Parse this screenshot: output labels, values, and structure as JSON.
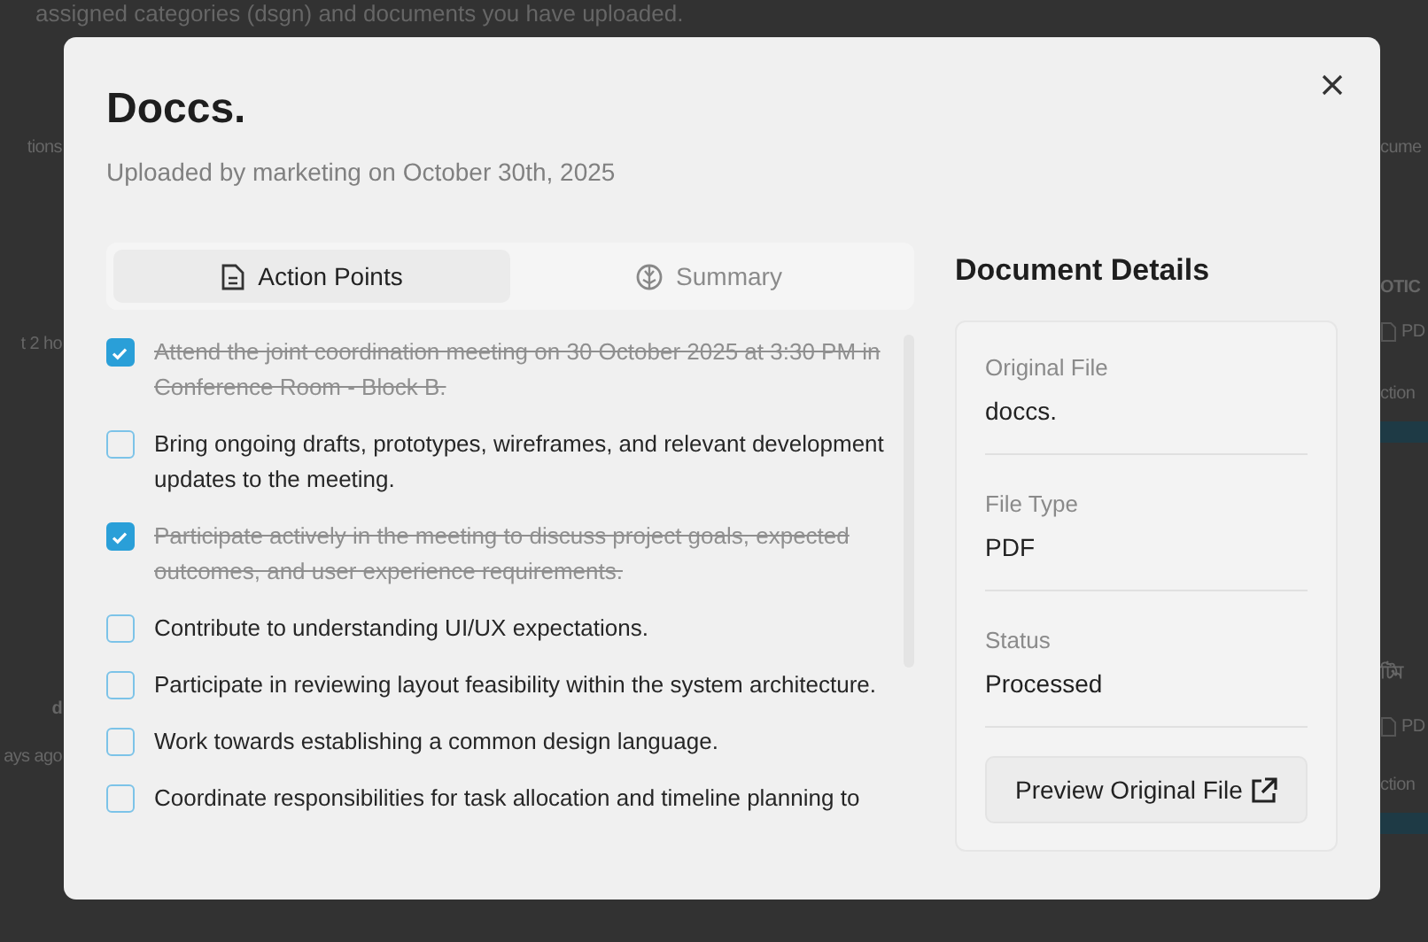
{
  "background_page": {
    "intro": "assigned categories (dsgn) and documents you have uploaded.",
    "left_strip": [
      {
        "kind": "tab",
        "text": "tions"
      },
      {
        "kind": "meta",
        "text": "t 2 ho"
      },
      {
        "kind": "title",
        "text": "d"
      },
      {
        "kind": "meta",
        "text": "ays ago"
      }
    ],
    "right_strip": [
      {
        "kind": "tab",
        "text": "cume"
      },
      {
        "kind": "title",
        "text": "OTIC"
      },
      {
        "kind": "file",
        "text": "PD"
      },
      {
        "kind": "action",
        "text": "ction"
      },
      {
        "kind": "title",
        "text": "টিম"
      },
      {
        "kind": "file",
        "text": "PD"
      },
      {
        "kind": "action",
        "text": "ction"
      }
    ]
  },
  "dialog": {
    "title": "Doccs.",
    "subtitle": "Uploaded by marketing on October 30th, 2025",
    "tabs": [
      {
        "label": "Action Points",
        "selected": true
      },
      {
        "label": "Summary",
        "selected": false
      }
    ],
    "action_points": [
      {
        "text": "Attend the joint coordination meeting on 30 October 2025 at 3:30 PM in Conference Room - Block B.",
        "checked": true
      },
      {
        "text": "Bring ongoing drafts, prototypes, wireframes, and relevant development updates to the meeting.",
        "checked": false
      },
      {
        "text": "Participate actively in the meeting to discuss project goals, expected outcomes, and user experience requirements.",
        "checked": true
      },
      {
        "text": "Contribute to understanding UI/UX expectations.",
        "checked": false
      },
      {
        "text": "Participate in reviewing layout feasibility within the system architecture.",
        "checked": false
      },
      {
        "text": "Work towards establishing a common design language.",
        "checked": false
      },
      {
        "text": "Coordinate responsibilities for task allocation and timeline planning to",
        "checked": false
      }
    ],
    "details": {
      "heading": "Document Details",
      "fields": [
        {
          "label": "Original File",
          "value": "doccs."
        },
        {
          "label": "File Type",
          "value": "PDF"
        },
        {
          "label": "Status",
          "value": "Processed"
        }
      ],
      "button": "Preview Original File"
    }
  }
}
